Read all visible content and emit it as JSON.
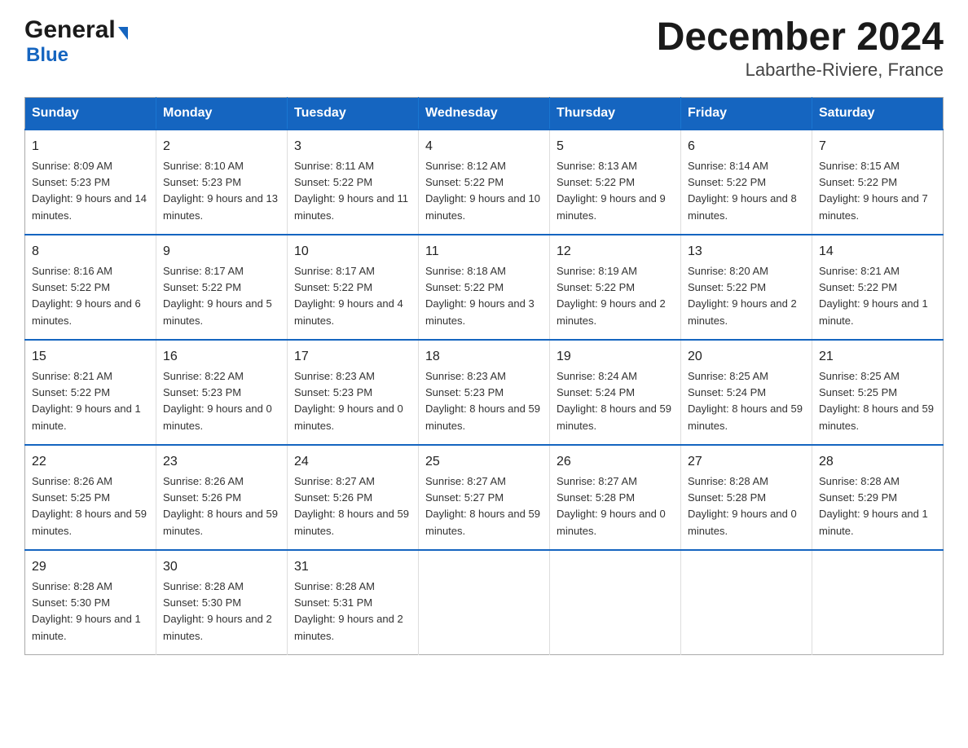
{
  "logo": {
    "general": "General",
    "blue": "Blue"
  },
  "title": "December 2024",
  "location": "Labarthe-Riviere, France",
  "weekdays": [
    "Sunday",
    "Monday",
    "Tuesday",
    "Wednesday",
    "Thursday",
    "Friday",
    "Saturday"
  ],
  "weeks": [
    [
      {
        "day": "1",
        "sunrise": "8:09 AM",
        "sunset": "5:23 PM",
        "daylight": "9 hours and 14 minutes."
      },
      {
        "day": "2",
        "sunrise": "8:10 AM",
        "sunset": "5:23 PM",
        "daylight": "9 hours and 13 minutes."
      },
      {
        "day": "3",
        "sunrise": "8:11 AM",
        "sunset": "5:22 PM",
        "daylight": "9 hours and 11 minutes."
      },
      {
        "day": "4",
        "sunrise": "8:12 AM",
        "sunset": "5:22 PM",
        "daylight": "9 hours and 10 minutes."
      },
      {
        "day": "5",
        "sunrise": "8:13 AM",
        "sunset": "5:22 PM",
        "daylight": "9 hours and 9 minutes."
      },
      {
        "day": "6",
        "sunrise": "8:14 AM",
        "sunset": "5:22 PM",
        "daylight": "9 hours and 8 minutes."
      },
      {
        "day": "7",
        "sunrise": "8:15 AM",
        "sunset": "5:22 PM",
        "daylight": "9 hours and 7 minutes."
      }
    ],
    [
      {
        "day": "8",
        "sunrise": "8:16 AM",
        "sunset": "5:22 PM",
        "daylight": "9 hours and 6 minutes."
      },
      {
        "day": "9",
        "sunrise": "8:17 AM",
        "sunset": "5:22 PM",
        "daylight": "9 hours and 5 minutes."
      },
      {
        "day": "10",
        "sunrise": "8:17 AM",
        "sunset": "5:22 PM",
        "daylight": "9 hours and 4 minutes."
      },
      {
        "day": "11",
        "sunrise": "8:18 AM",
        "sunset": "5:22 PM",
        "daylight": "9 hours and 3 minutes."
      },
      {
        "day": "12",
        "sunrise": "8:19 AM",
        "sunset": "5:22 PM",
        "daylight": "9 hours and 2 minutes."
      },
      {
        "day": "13",
        "sunrise": "8:20 AM",
        "sunset": "5:22 PM",
        "daylight": "9 hours and 2 minutes."
      },
      {
        "day": "14",
        "sunrise": "8:21 AM",
        "sunset": "5:22 PM",
        "daylight": "9 hours and 1 minute."
      }
    ],
    [
      {
        "day": "15",
        "sunrise": "8:21 AM",
        "sunset": "5:22 PM",
        "daylight": "9 hours and 1 minute."
      },
      {
        "day": "16",
        "sunrise": "8:22 AM",
        "sunset": "5:23 PM",
        "daylight": "9 hours and 0 minutes."
      },
      {
        "day": "17",
        "sunrise": "8:23 AM",
        "sunset": "5:23 PM",
        "daylight": "9 hours and 0 minutes."
      },
      {
        "day": "18",
        "sunrise": "8:23 AM",
        "sunset": "5:23 PM",
        "daylight": "8 hours and 59 minutes."
      },
      {
        "day": "19",
        "sunrise": "8:24 AM",
        "sunset": "5:24 PM",
        "daylight": "8 hours and 59 minutes."
      },
      {
        "day": "20",
        "sunrise": "8:25 AM",
        "sunset": "5:24 PM",
        "daylight": "8 hours and 59 minutes."
      },
      {
        "day": "21",
        "sunrise": "8:25 AM",
        "sunset": "5:25 PM",
        "daylight": "8 hours and 59 minutes."
      }
    ],
    [
      {
        "day": "22",
        "sunrise": "8:26 AM",
        "sunset": "5:25 PM",
        "daylight": "8 hours and 59 minutes."
      },
      {
        "day": "23",
        "sunrise": "8:26 AM",
        "sunset": "5:26 PM",
        "daylight": "8 hours and 59 minutes."
      },
      {
        "day": "24",
        "sunrise": "8:27 AM",
        "sunset": "5:26 PM",
        "daylight": "8 hours and 59 minutes."
      },
      {
        "day": "25",
        "sunrise": "8:27 AM",
        "sunset": "5:27 PM",
        "daylight": "8 hours and 59 minutes."
      },
      {
        "day": "26",
        "sunrise": "8:27 AM",
        "sunset": "5:28 PM",
        "daylight": "9 hours and 0 minutes."
      },
      {
        "day": "27",
        "sunrise": "8:28 AM",
        "sunset": "5:28 PM",
        "daylight": "9 hours and 0 minutes."
      },
      {
        "day": "28",
        "sunrise": "8:28 AM",
        "sunset": "5:29 PM",
        "daylight": "9 hours and 1 minute."
      }
    ],
    [
      {
        "day": "29",
        "sunrise": "8:28 AM",
        "sunset": "5:30 PM",
        "daylight": "9 hours and 1 minute."
      },
      {
        "day": "30",
        "sunrise": "8:28 AM",
        "sunset": "5:30 PM",
        "daylight": "9 hours and 2 minutes."
      },
      {
        "day": "31",
        "sunrise": "8:28 AM",
        "sunset": "5:31 PM",
        "daylight": "9 hours and 2 minutes."
      },
      null,
      null,
      null,
      null
    ]
  ]
}
